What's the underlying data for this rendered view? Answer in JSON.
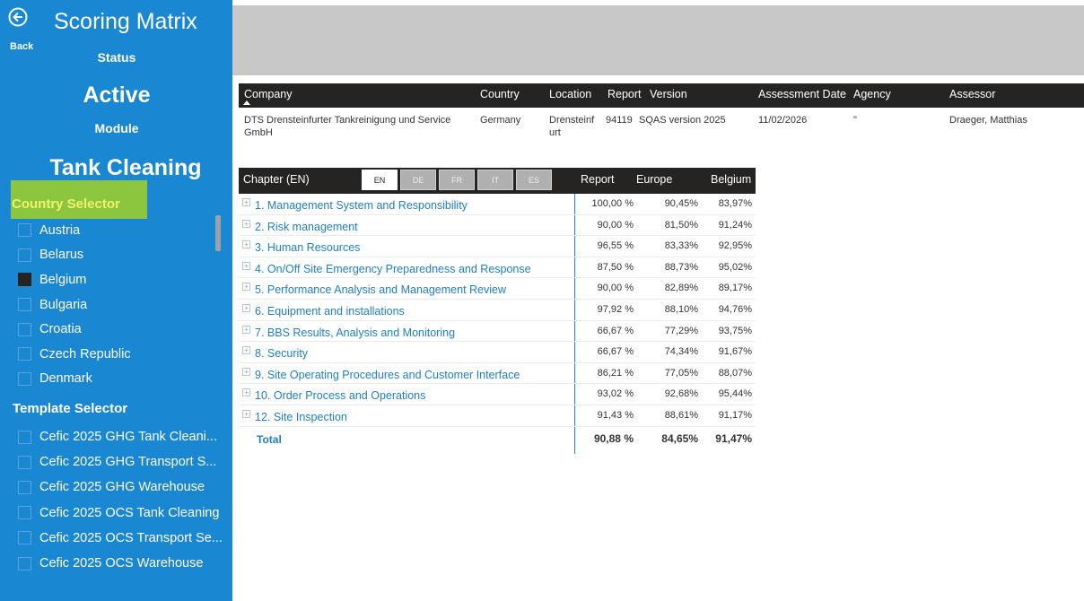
{
  "app": {
    "title": "Scoring Matrix",
    "back_label": "Back"
  },
  "sidebar": {
    "status_label": "Status",
    "status_value": "Active",
    "module_label": "Module",
    "module_value": "Tank Cleaning",
    "country_selector_label": "Country Selector",
    "countries": [
      {
        "label": "Austria",
        "checked": false
      },
      {
        "label": "Belarus",
        "checked": false
      },
      {
        "label": "Belgium",
        "checked": true
      },
      {
        "label": "Bulgaria",
        "checked": false
      },
      {
        "label": "Croatia",
        "checked": false
      },
      {
        "label": "Czech Republic",
        "checked": false
      },
      {
        "label": "Denmark",
        "checked": false
      }
    ],
    "template_selector_label": "Template Selector",
    "templates": [
      {
        "label": "Cefic 2025 GHG Tank Cleani...",
        "checked": false
      },
      {
        "label": "Cefic 2025 GHG Transport S...",
        "checked": false
      },
      {
        "label": "Cefic 2025 GHG Warehouse",
        "checked": false
      },
      {
        "label": "Cefic 2025 OCS Tank Cleaning",
        "checked": false
      },
      {
        "label": "Cefic 2025 OCS Transport Se...",
        "checked": false
      },
      {
        "label": "Cefic 2025 OCS Warehouse",
        "checked": false
      }
    ]
  },
  "company_table": {
    "headers": {
      "company": "Company",
      "country": "Country",
      "location": "Location",
      "report": "Report",
      "version": "Version",
      "assessment_date": "Assessment Date",
      "agency": "Agency",
      "assessor": "Assessor"
    },
    "row": {
      "company": "DTS Drensteinfurter Tankreinigung und Service GmbH",
      "country": "Germany",
      "location": "Drensteinfurt",
      "report": "94119",
      "version": "SQAS version 2025",
      "assessment_date": "11/02/2026",
      "agency": "\"",
      "assessor": "Draeger, Matthias"
    }
  },
  "matrix": {
    "headers": {
      "chapter": "Chapter (EN)",
      "report": "Report",
      "europe": "Europe",
      "country": "Belgium"
    },
    "languages": [
      {
        "label": "EN",
        "active": true
      },
      {
        "label": "DE",
        "active": false
      },
      {
        "label": "FR",
        "active": false
      },
      {
        "label": "IT",
        "active": false
      },
      {
        "label": "ES",
        "active": false
      }
    ],
    "rows": [
      {
        "chapter": "1. Management System and Responsibility",
        "report": "100,00 %",
        "europe": "90,45%",
        "country": "83,97%"
      },
      {
        "chapter": "2. Risk management",
        "report": "90,00 %",
        "europe": "81,50%",
        "country": "91,24%"
      },
      {
        "chapter": "3. Human Resources",
        "report": "96,55 %",
        "europe": "83,33%",
        "country": "92,95%"
      },
      {
        "chapter": "4. On/Off Site Emergency Preparedness and Response",
        "report": "87,50 %",
        "europe": "88,73%",
        "country": "95,02%"
      },
      {
        "chapter": "5. Performance Analysis and Management Review",
        "report": "90,00 %",
        "europe": "82,89%",
        "country": "89,17%"
      },
      {
        "chapter": "6. Equipment and installations",
        "report": "97,92 %",
        "europe": "88,10%",
        "country": "94,76%"
      },
      {
        "chapter": "7. BBS Results, Analysis and Monitoring",
        "report": "66,67 %",
        "europe": "77,29%",
        "country": "93,75%"
      },
      {
        "chapter": "8. Security",
        "report": "66,67 %",
        "europe": "74,34%",
        "country": "91,67%"
      },
      {
        "chapter": "9. Site Operating Procedures and Customer Interface",
        "report": "86,21 %",
        "europe": "77,05%",
        "country": "88,07%"
      },
      {
        "chapter": "10. Order Process and Operations",
        "report": "93,02 %",
        "europe": "92,68%",
        "country": "95,44%"
      },
      {
        "chapter": "12. Site Inspection",
        "report": "91,43 %",
        "europe": "88,61%",
        "country": "91,17%"
      }
    ],
    "total": {
      "label": "Total",
      "report": "90,88 %",
      "europe": "84,65%",
      "country": "91,47%"
    },
    "expand_glyph": "+"
  },
  "colors": {
    "sidebar_bg": "#1a87d3",
    "header_bg": "#252423",
    "selector_highlight": "#8cc63f",
    "link_blue": "#1f7fc4"
  }
}
